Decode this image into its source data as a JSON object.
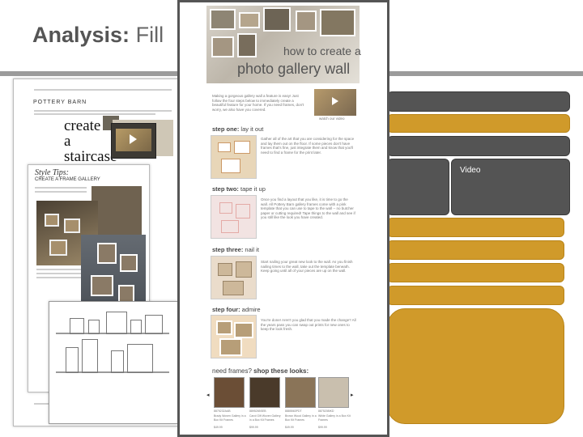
{
  "slide": {
    "title_bold": "Analysis:",
    "title_rest": "Fill"
  },
  "right_panel": {
    "video_label": "Video"
  },
  "document": {
    "hero_line1": "how to create a",
    "hero_line2": "photo gallery wall",
    "intro": "Making a gorgeous gallery wall a feature is easy! Just follow the four steps below to immediately create a beautiful feature for your home. If you need frames, don't worry, we also have you covered.",
    "video_caption": "watch our video",
    "steps": [
      {
        "label_bold": "step one:",
        "label_rest": " lay it out",
        "text": "Gather all of the art that you are considering for the space and lay them out on the floor. If some pieces don't have frames that's fine, just integrate them and know that you'll need to find a frame for the print later."
      },
      {
        "label_bold": "step two:",
        "label_rest": " tape it up",
        "text": "Once you find a layout that you like, it is time to go the wall. All Pottery Barn gallery frames come with a pink template that you can use to tape to the wall -- no butcher paper or cutting required! Tape things to the wall and see if you still like the look you have created."
      },
      {
        "label_bold": "step three:",
        "label_rest": " nail it",
        "text": "Start nailing your great new look to the wall. As you finish nailing times to the wall, take out the template beneath. Keep going until all of your pieces are up on the wall."
      },
      {
        "label_bold": "step four:",
        "label_rest": " admire",
        "text": "You're done! Aren't you glad that you made the change? All the years pass you can swap out prints for new ones to keep the look fresh."
      }
    ],
    "shop_label_prefix": "need frames?",
    "shop_label_bold": "shop these looks:",
    "prev_arrow": "◂",
    "next_arrow": "▸",
    "products": [
      {
        "id": "8875232AAB",
        "name": "Brady Woven Gallery in a Box Kit Frames",
        "price": "$49.99"
      },
      {
        "id": "8895265SEB",
        "name": "Carol Gift Woven Gallery in a Box Kit Frames",
        "price": "$99.99"
      },
      {
        "id": "8885563PDT",
        "name": "Brown Wood Gallery in a Box Kit Frames",
        "price": "$49.99"
      },
      {
        "id": "8875208IKD",
        "name": "White Gallery in a Box Kit Frames",
        "price": "$99.99"
      }
    ]
  },
  "left_collage": {
    "brand": "POTTERY BARN",
    "article_heading": "create a staircase",
    "style_tips_title": "Style Tips:",
    "style_tips_sub": "CREATE A FRAME GALLERY"
  },
  "colors": {
    "dark_panel": "#545454",
    "gold_panel": "#d09a2a",
    "rule": "#9b9b9b"
  }
}
